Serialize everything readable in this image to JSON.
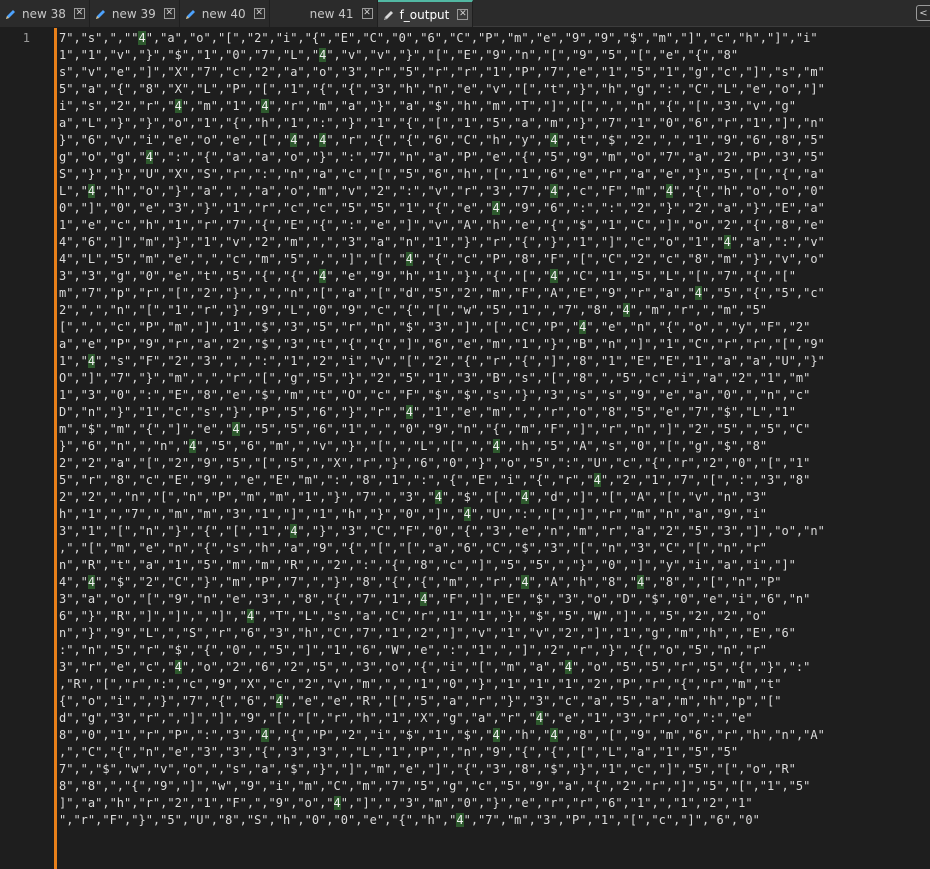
{
  "tabs": [
    {
      "label": "new 38",
      "modified": true,
      "active": false
    },
    {
      "label": "new 39",
      "modified": true,
      "active": false
    },
    {
      "label": "new 40",
      "modified": true,
      "active": false
    },
    {
      "label": "new 41",
      "modified": false,
      "active": false
    },
    {
      "label": "f_output",
      "modified": true,
      "active": true
    }
  ],
  "editor": {
    "line_number": "1",
    "highlight_token": "4",
    "highlight_color": "#2e5a2e",
    "change_bar_color": "#e8801a",
    "lines": [
      "7\",\"s\",\",\"\"4\",\"a\",\"o\",\"[\",\"2\",\"i\",\"{\",\"E\",\"C\",\"0\",\"6\",\"C\",\"P\",\"m\",\"e\",\"9\",\"9\",\"$\",\"m\",\"]\",\"c\",\"h\",\"]\",\"i\"",
      "1\",\"1\",\"v\",\"}\",\"$\",\"1\",\"0\",\"7\",\"L\",\"4\",\"v\",\"v\",\"}\",\"[\",\"E\",\"9\",\"n\",\"[\",\"9\",\"5\",\"[\",\"e\",\"{\",\"8\"",
      "s\",\"v\",\"e\",\"]\",\"X\",\"7\",\"c\",\"2\",\"a\",\"o\",\"3\",\"r\",\"5\",\"r\",\"r\",\"1\",\"P\",\"7\",\"e\",\"1\",\"5\",\"1\",\"g\",\"c\",\"]\",\"s\",\"m\"",
      "5\",\"a\",\"{\",\"8\",\"X\",\"L\",\"P\",\"[\",\"1\",\"{\",\"{\",\"3\",\"h\",\"n\",\"e\",\"v\",\"[\",\"t\",\"}\",\"h\",\"g\",\":\",\"C\",\"L\",\"e\",\"o\",\"]\"",
      "i\",\"s\",\"2\",\"r\",\"4\",\"m\",\"1\",\"4\",\"r\",\"m\",\"a\",\"}\",\"a\",\"$\",\"h\",\"m\",\"T\",\"]\",\"[\",\",\",\"n\",\"{\",\"[\",\"3\",\"v\",\"g\"",
      "a\",\"L\",\"}\",\"}\",\"o\",\"1\",\"{\",\"h\",\"1\",\":\",\"}\",\"1\",\"{\",\"[\",\"1\",\"5\",\"a\",\"m\",\"}\",\"7\",\"1\",\"0\",\"6\",\"r\",\"1\",\"]\",\"n\"",
      "}\",\"6\",\"v\",\"i\",\"e\",\"o\",\"e\",\"[\",\"4\",\"4\",\"r\",\"{\",\"{\",\"6\",\"C\",\"h\",\"y\",\"4\",\"t\",\"$\",\"2\",\",\",\"1\",\"9\",\"6\",\"8\",\"5\"",
      "g\",\"o\",\"g\",\"4\",\":\",\"{\",\"a\",\"a\",\"o\",\"}\",\":\",\"7\",\"n\",\"a\",\"P\",\"e\",\"{\",\"5\",\"9\",\"m\",\"o\",\"7\",\"a\",\"2\",\"P\",\"3\",\"5\"",
      "S\",\"}\",\"}\",\"U\",\"X\",\"S\",\"r\",\":\",\"n\",\"a\",\"c\",\"[\",\"5\",\"6\",\"h\",\"[\",\"1\",\"6\",\"e\",\"r\",\"a\",\"e\",\"}\",\"5\",\"[\",\"{\",\"a\"",
      "L\",\"4\",\"h\",\"o\",\"}\",\"a\",\",\",\"a\",\"o\",\"m\",\"v\",\"2\",\":\",\"v\",\"r\",\"3\",\"7\",\"4\",\"c\",\"F\",\"m\",\"4\",\"{\",\"h\",\"o\",\"o\",\"0\"",
      "0\",\"]\",\"0\",\"e\",\"3\",\"}\",\"1\",\"r\",\"c\",\"c\",\"5\",\"5\",\"1\",\"{\",\"e\",\"4\",\"9\",\"6\",\":\",\":\",\"2\",\"}\",\"2\",\"a\",\"}\",\"E\",\"a\"",
      "1\",\"e\",\"c\",\"h\",\"1\",\"r\",\"7\",\"{\",\"E\",\"{\",\":\",\"e\",\"]\",\"v\",\"A\",\"h\",\"e\",\"{\",\"$\",\"1\",\"C\",\"]\",\"o\",\"2\",\"{\",\"8\",\"e\"",
      "4\",\"6\",\"]\",\"m\",\"}\",\"1\",\"v\",\"2\",\"m\",\",\",\"3\",\"a\",\"n\",\"1\",\"}\",\"r\",\"{\",\"}\",\"1\",\"]\",\"c\",\"o\",\"1\",\"4\",\"a\",\":\",\"v\"",
      "4\",\"L\",\"5\",\"m\",\"e\",\",\",\"c\",\"m\",\"5\",\",\",\"]\",\"[\",\"4\",\"{\",\"c\",\"P\",\"8\",\"F\",\"[\",\"C\",\"2\",\"c\",\"8\",\"m\",\"}\",\"v\",\"o\"",
      "3\",\"3\",\"g\",\"0\",\"e\",\"t\",\"5\",\"{\",\"{\",\"4\",\"e\",\"9\",\"h\",\"1\",\"}\",\"{\",\"[\",\"4\",\"C\",\"1\",\"5\",\"L\",\"[\",\"7\",\"{\",\"[\"",
      "m\",\"7\",\"p\",\"r\",\"[\",\"2\",\"}\",\",\",\"n\",\"[\",\"a\",\"[\",\"d\",\"5\",\"2\",\"m\",\"F\",\"A\",\"E\",\"9\",\"r\",\"a\",\"4\",\"5\",\"{\",\"5\",\"c\"",
      "2\",\",\",\"n\",\"[\",\"1\",\"r\",\"}\",\"9\",\"L\",\"0\",\"9\",\"c\",\"{\",\"[\",\"w\",\"5\",\"1\",\",\"7\",\"8\",\"4\",\"m\",\"r\",\",\"m\",\"5\"",
      "[\",\",\",\"c\",\"P\",\"m\",\"]\",\"1\",\"$\",\"3\",\"5\",\"r\",\"n\",\"$\",\"3\",\"]\",\"[\",\"C\",\"P\",\"4\",\"e\",\"n\",\"{\",\"o\",\",\"y\",\"F\",\"2\"",
      "a\",\"e\",\"P\",\"9\",\"r\",\"a\",\"2\",\"$\",\"3\",\"t\",\"{\",\"{\",\"]\",\"6\",\"e\",\"m\",\"1\",\"}\",\"B\",\"n\",\"]\",\"1\",\"C\",\"r\",\"r\",\"[\",\"9\"",
      "1\",\"4\",\"s\",\"F\",\"2\",\"3\",\",\",\":\",\"1\",\"2\",\"i\",\"v\",\"[\",\"2\",\"{\",\"r\",\"{\",\"]\",\"8\",\"1\",\"E\",\"E\",\"1\",\"a\",\"a\",\"U\",\"}\"",
      "O\",\"]\",\"7\",\"}\",\"m\",\",\",\"r\",\"[\",\"g\",\"5\",\"}\",\"2\",\"5\",\"1\",\"3\",\"B\",\"s\",\"[\",\"8\",\",\"5\",\"c\",\"i\",\"a\",\"2\",\"1\",\"m\"",
      "1\",\"3\",\"0\",\":\",\"E\",\"8\",\"e\",\"$\",\"m\",\"t\",\"O\",\"c\",\"F\",\"$\",\"$\",\"s\",\"}\",\"3\",\"s\",\"s\",\"9\",\"e\",\"a\",\"0\",\",\"n\",\"c\"",
      "D\",\"n\",\"}\",\"1\",\"c\",\"s\",\"}\",\"P\",\"5\",\"6\",\"}\",\"r\",\"4\",\"1\",\"e\",\"m\",\",\",\"r\",\"o\",\"8\",\"5\",\"e\",\"7\",\"$\",\"L\",\"1\"",
      "m\",\"$\",\"m\",\"{\",\"]\",\"e\",\"4\",\"5\",\"5\",\"6\",\"1\",\",\",\"0\",\"9\",\"n\",\"{\",\"m\",\"F\",\"]\",\"r\",\"n\",\"]\",\"2\",\"5\",\",\"5\",\"C\"",
      "}\",\"6\",\"n\",\",\"n\",\"4\",\"5\",\"6\",\"m\",\",\"v\",\"}\",\"[\",\",\"L\",\"[\",\",\"4\",\"h\",\"5\",\"A\",\"s\",\"0\",\"[\",\"g\",\"$\",\"8\"",
      "2\",\"2\",\"a\",\"[\",\"2\",\"9\",\"5\",\"[\",\"5\",\",\"X\",\"r\",\"}\",\"6\",\"0\",\"}\",\"o\",\"5\",\":\",\"U\",\"c\",\"{\",\"r\",\"2\",\"0\",\"[\",\"1\"",
      "5\",\"r\",\"8\",\"c\",\"E\",\"9\",\",\"e\",\"E\",\"m\",\":\",\"8\",\"1\",\":\",\"{\",\"E\",\"i\",\"{\",\"r\",\"4\",\"2\",\"1\",\"7\",\"[\",\":\",\"3\",\"8\"",
      "2\",\"2\",\",\"n\",\"[\",\"n\",\"P\",\"m\",\"m\",\"1\",\"}\",\"7\",\",\"3\",\"4\",\"$\",\"[\",\"4\",\"d\",\"]\",\"[\",\"A\",\"[\",\"v\",\"n\",\"3\"",
      "h\",\"1\",\",\"7\",\",\"m\",\"m\",\"3\",\"1\",\"]\",\"1\",\"h\",\"}\",\"0\",\"]\",\"4\",\"U\",\":\",\"[\",\"]\",\"r\",\"m\",\"n\",\"a\",\"9\",\"i\"",
      "3\",\"1\",\"[\",\"n\",\"}\",\"{\",\"[\",\"1\",\"4\",\"}\",\"3\",\"C\",\"F\",\"0\",\"{\",\"3\",\"e\",\"n\",\"m\",\"r\",\"a\",\"2\",\"5\",\"3\",\"]\",\"o\",\"n\"",
      ",\",\"[\",\"m\",\"e\",\"n\",\"{\",\"s\",\"h\",\"a\",\"9\",\"{\",\"[\",\"[\",\"a\",\"6\",\"C\",\"$\",\"3\",\"[\",\"n\",\"3\",\"C\",\"[\",\"n\",\"r\"",
      "n\",\"R\",\"t\",\"a\",\"1\",\"5\",\"m\",\"m\",\"R\",\",\"2\",\":\",\"{\",\"8\",\"c\",\"]\",\"5\",\"5\",\",\"}\",\"0\",\"]\",\"y\",\"i\",\"a\",\"i\",\"]\"",
      "4\",\"4\",\"$\",\"2\",\"C\",\"}\",\"m\",\"P\",\"7\",\",\"}\",\"8\",\"{\",\"{\",\"m\",\",\"r\",\"4\",\"A\",\"h\",\"8\",\"4\",\"8\",\",\"[\",\"n\",\"P\"",
      "3\",\"a\",\"o\",\"[\",\"9\",\"n\",\"e\",\"3\",\",\"8\",\"{\",\"7\",\"1\",\"4\",\"F\",\"]\",\"E\",\"$\",\"3\",\"o\",\"D\",\"$\",\"0\",\"e\",\"i\",\"6\",\"n\"",
      "6\",\"}\",\"R\",\"]\",\"]\",\",\"]\",\"4\",\"T\",\"L\",\"s\",\"a\",\"C\",\"r\",\"1\",\"1\",\"}\",\"$\",\"5\",\"W\",\"]\",\",\"5\",\"2\",\"2\",\"o\"",
      "n\",\"}\",\"9\",\"L\",\",\"S\",\"r\",\"6\",\"3\",\"h\",\"C\",\"7\",\"1\",\"2\",\"]\",\"v\",\"1\",\"v\",\"2\",\"]\",\"1\",\"g\",\"m\",\"h\",\",\"E\",\"6\"",
      ":\",\"n\",\"5\",\"r\",\"$\",\"{\",\"0\",\",\"5\",\"]\",\"1\",\"6\",\"W\",\"e\",\":\",\"1\",\",\"]\",\"2\",\"r\",\"}\",\"{\",\"o\",\"5\",\"n\",\"r\"",
      "3\",\"r\",\"e\",\"c\",\"4\",\"o\",\"2\",\"6\",\"2\",\"5\",\",\"3\",\"o\",\"{\",\"i\",\"[\",\"m\",\"a\",\"4\",\"o\",\"5\",\"5\",\"r\",\"5\",\"{\",\"}\",\":\"",
      ",\"R\",\"[\",\"r\",\":\",\"c\",\"9\",\"X\",\"c\",\"2\",\"v\",\"m\",\",\",\"1\",\"0\",\"}\",\"1\",\"1\",\"1\",\"2\",\"P\",\"r\",\"{\",\"r\",\"m\",\"t\"",
      "{\",\"o\",\"i\",\",\"}\",\"7\",\"{\",\"6\",\"4\",\"e\",\"e\",\"R\",\"[\",\"5\",\"a\",\"r\",\"}\",\"3\",\"c\",\"a\",\"5\",\"a\",\"m\",\"h\",\"p\",\"[\"",
      "d\",\"g\",\"3\",\"r\",\",\"]\",\"]\",\"9\",\"[\",\"[\",\"r\",\"h\",\"1\",\"X\",\"g\",\"a\",\"r\",\"4\",\"e\",\"1\",\"3\",\"r\",\"o\",\":\",\"e\"",
      "8\",\"0\",\"1\",\"r\",\"P\",\":\",\"3\",\"4\",\"{\",\"P\",\"2\",\"i\",\"$\",\"1\",\"$\",\"4\",\"h\",\"4\",\"8\",\"[\",\"9\",\"m\",\"6\",\"r\",\"h\",\"n\",\"A\"",
      ",\",\"C\",\"{\",\"n\",\"e\",\"3\",\"3\",\"{\",\"3\",\"3\",\",\"L\",\"1\",\"P\",\",\"n\",\"9\",\"{\",\"{\",\"[\",\"L\",\"a\",\"1\",\"5\",\"5\"",
      "7\",\",\"$\",\"w\",\"v\",\"o\",\",\"s\",\"a\",\"$\",\"}\",\"]\",\"m\",\"e\",\"]\",\"{\",\"3\",\"8\",\"$\",\"}\",\"1\",\"c\",\"]\",\"5\",\"[\",\"o\",\"R\"",
      "8\",\"8\",\",\"{\",\"9\",\"]\",\"w\",\"9\",\"i\",\"m\",\"C\",\"m\",\"7\",\"5\",\"g\",\"c\",\"5\",\"9\",\"a\",\"{\",\"2\",\"r\",\"]\",\"5\",\"[\",\"1\",\"5\"",
      "]\",\"a\",\"h\",\"r\",\"2\",\"1\",\"F\",\",\"9\",\"o\",\"4\",\"]\",\",\"3\",\"m\",\"0\",\"}\",\"e\",\"r\",\"r\",\"6\",\"1\",\",\"1\",\"2\",\"1\"",
      "\",\"r\",\"F\",\"}\",\"5\",\"U\",\"8\",\"S\",\"h\",\"0\",\"0\",\"e\",\"{\",\"h\",\"4\",\"7\",\"m\",\"3\",\"P\",\"1\",\"[\",\"c\",\"]\",\"6\",\"0\""
    ]
  }
}
